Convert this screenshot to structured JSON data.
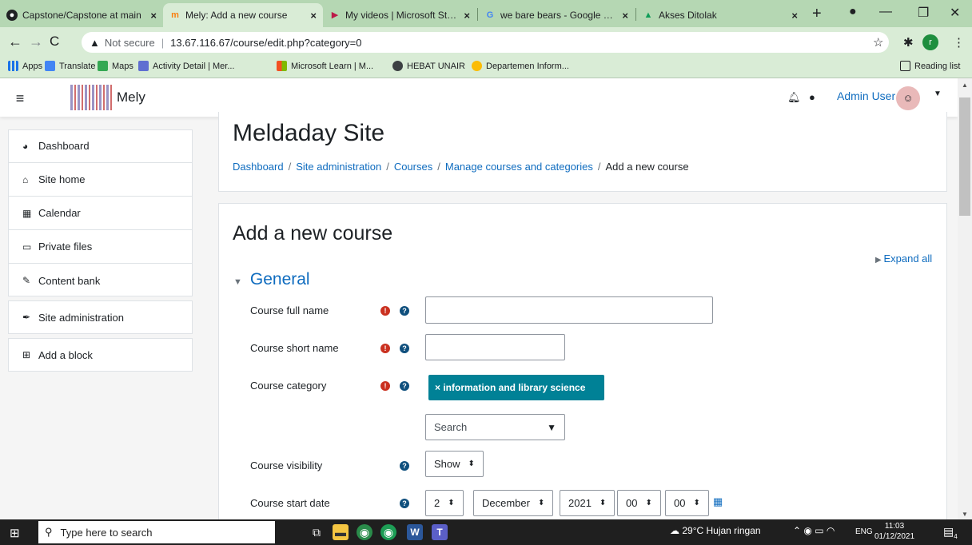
{
  "browser": {
    "tabs": [
      {
        "title": "Capstone/Capstone at main",
        "icon": "github-icon"
      },
      {
        "title": "Mely: Add a new course",
        "icon": "moodle-icon",
        "active": true
      },
      {
        "title": "My videos | Microsoft Stream",
        "icon": "stream-icon"
      },
      {
        "title": "we bare bears - Google Pene",
        "icon": "google-icon"
      },
      {
        "title": "Akses Ditolak",
        "icon": "drive-icon"
      }
    ],
    "security_label": "Not secure",
    "url": "13.67.116.67/course/edit.php?category=0",
    "avatar_letter": "r",
    "bookmarks": [
      "Apps",
      "Translate",
      "Maps",
      "Activity Detail | Mer...",
      "Microsoft Learn | M...",
      "HEBAT UNAIR",
      "Departemen Inform..."
    ],
    "reading_list": "Reading list"
  },
  "navbar": {
    "site_name": "Mely",
    "user_name": "Admin User"
  },
  "sidebar": {
    "items": [
      {
        "label": "Dashboard",
        "icon": "dashboard-icon"
      },
      {
        "label": "Site home",
        "icon": "home-icon"
      },
      {
        "label": "Calendar",
        "icon": "calendar-icon"
      },
      {
        "label": "Private files",
        "icon": "file-icon"
      },
      {
        "label": "Content bank",
        "icon": "brush-icon"
      }
    ],
    "admin": {
      "label": "Site administration",
      "icon": "wrench-icon"
    },
    "add_block": {
      "label": "Add a block",
      "icon": "plus-square-icon"
    }
  },
  "header": {
    "title": "Meldaday Site",
    "breadcrumb": [
      "Dashboard",
      "Site administration",
      "Courses",
      "Manage courses and categories"
    ],
    "breadcrumb_current": "Add a new course"
  },
  "form": {
    "title": "Add a new course",
    "expand_all": "Expand all",
    "section": "General",
    "fields": {
      "fullname": {
        "label": "Course full name",
        "value": ""
      },
      "shortname": {
        "label": "Course short name",
        "value": ""
      },
      "category": {
        "label": "Course category",
        "chip": "× information and library science",
        "search_placeholder": "Search"
      },
      "visibility": {
        "label": "Course visibility",
        "value": "Show"
      },
      "startdate": {
        "label": "Course start date",
        "day": "2",
        "month": "December",
        "year": "2021",
        "hour": "00",
        "minute": "00"
      }
    }
  },
  "taskbar": {
    "search_placeholder": "Type here to search",
    "weather": "29°C  Hujan ringan",
    "lang": "ENG",
    "time": "11:03",
    "date": "01/12/2021",
    "notif_count": "4"
  },
  "colors": {
    "accent": "#0f6cbf",
    "category_chip": "#008196",
    "required": "#ca3120",
    "browser_frame": "#b5d7b3"
  }
}
